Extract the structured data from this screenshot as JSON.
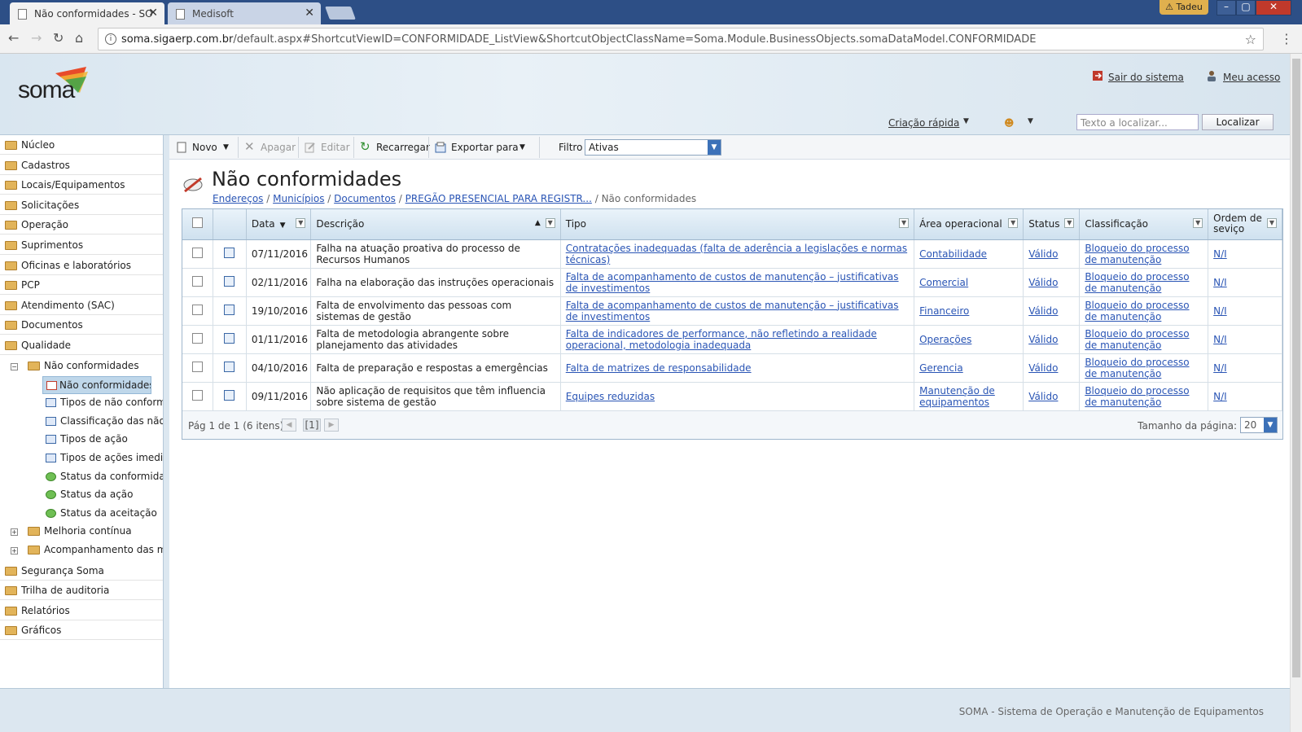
{
  "browser": {
    "tabs": [
      {
        "label": "Não conformidades - SO",
        "active": true
      },
      {
        "label": "Medisoft",
        "active": false
      }
    ],
    "user_badge": "Tadeu",
    "url_host": "soma.sigaerp.com.br",
    "url_path": "/default.aspx#ShortcutViewID=CONFORMIDADE_ListView&ShortcutObjectClassName=Soma.Module.BusinessObjects.somaDataModel.CONFORMIDADE"
  },
  "header": {
    "logo": "soma",
    "logout": "Sair do sistema",
    "my_access": "Meu acesso",
    "quick_create": "Criação rápida",
    "search_placeholder": "Texto a localizar...",
    "search_button": "Localizar"
  },
  "sidebar": {
    "items": [
      "Núcleo",
      "Cadastros",
      "Locais/Equipamentos",
      "Solicitações",
      "Operação",
      "Suprimentos",
      "Oficinas e laboratórios",
      "PCP",
      "Atendimento (SAC)",
      "Documentos",
      "Qualidade"
    ],
    "quality_group": "Não conformidades",
    "quality_children": [
      "Não conformidades",
      "Tipos de não conformi",
      "Classificação das não c",
      "Tipos de ação",
      "Tipos de ações imediat",
      "Status da conformidade",
      "Status da ação",
      "Status da aceitação"
    ],
    "quality_more": [
      "Melhoria contínua",
      "Acompanhamento das mell"
    ],
    "bottom_items": [
      "Segurança Soma",
      "Trilha de auditoria",
      "Relatórios",
      "Gráficos"
    ]
  },
  "toolbar": {
    "new": "Novo",
    "delete": "Apagar",
    "edit": "Editar",
    "reload": "Recarregar",
    "export": "Exportar para",
    "filter_label": "Filtro",
    "filter_value": "Ativas"
  },
  "view": {
    "title": "Não conformidades",
    "breadcrumb": [
      "Endereços",
      "Municípios",
      "Documentos",
      "PREGÃO PRESENCIAL PARA REGISTR..."
    ],
    "breadcrumb_current": "Não conformidades"
  },
  "grid": {
    "columns": [
      "Data",
      "Descrição",
      "Tipo",
      "Área operacional",
      "Status",
      "Classificação",
      "Ordem de seviço"
    ],
    "rows": [
      {
        "data": "07/11/2016",
        "descricao": "Falha na atuação proativa do processo de Recursos Humanos",
        "tipo": "Contratações inadequadas (falta de aderência a legislações e normas técnicas)",
        "area": "Contabilidade",
        "status": "Válido",
        "classificacao": "Bloqueio do processo de manutenção",
        "ordem": "N/I"
      },
      {
        "data": "02/11/2016",
        "descricao": "Falha na elaboração das instruções operacionais",
        "tipo": "Falta de acompanhamento de custos de manutenção – justificativas de investimentos",
        "area": "Comercial",
        "status": "Válido",
        "classificacao": "Bloqueio do processo de manutenção",
        "ordem": "N/I"
      },
      {
        "data": "19/10/2016",
        "descricao": "Falta de envolvimento das pessoas com sistemas de gestão",
        "tipo": "Falta de acompanhamento de custos de manutenção – justificativas de investimentos",
        "area": "Financeiro",
        "status": "Válido",
        "classificacao": "Bloqueio do processo de manutenção",
        "ordem": "N/I"
      },
      {
        "data": "01/11/2016",
        "descricao": "Falta de metodologia abrangente sobre planejamento das atividades",
        "tipo": "Falta de indicadores de performance, não refletindo a realidade operacional, metodologia inadequada",
        "area": "Operações",
        "status": "Válido",
        "classificacao": "Bloqueio do processo de manutenção",
        "ordem": "N/I"
      },
      {
        "data": "04/10/2016",
        "descricao": "Falta de preparação e respostas a emergências",
        "tipo": "Falta de matrizes de responsabilidade",
        "area": "Gerencia",
        "status": "Válido",
        "classificacao": "Bloqueio do processo de manutenção",
        "ordem": "N/I"
      },
      {
        "data": "09/11/2016",
        "descricao": "Não aplicação de requisitos que têm influencia sobre sistema de gestão",
        "tipo": "Equipes reduzidas",
        "area": "Manutenção de equipamentos",
        "status": "Válido",
        "classificacao": "Bloqueio do processo de manutenção",
        "ordem": "N/I"
      }
    ],
    "pager_text": "Pág 1 de 1 (6 itens)",
    "current_page": "[1]",
    "page_size_label": "Tamanho da página:",
    "page_size": "20"
  },
  "footer": "SOMA - Sistema de Operação e Manutenção de Equipamentos"
}
